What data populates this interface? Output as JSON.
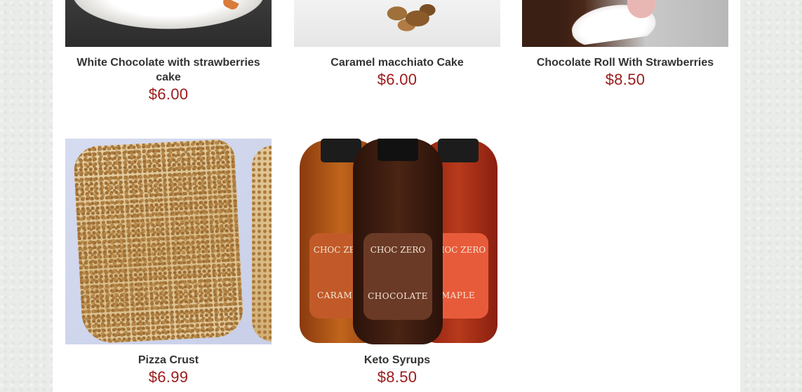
{
  "products": [
    {
      "title": "White Chocolate with strawberries cake",
      "price": "$6.00"
    },
    {
      "title": "Caramel macchiato Cake",
      "price": "$6.00"
    },
    {
      "title": "Chocolate Roll With Strawberries",
      "price": "$8.50"
    },
    {
      "title": "Pizza Crust",
      "price": "$6.99"
    },
    {
      "title": "Keto Syrups",
      "price": "$8.50"
    }
  ],
  "syrup_labels": {
    "brand": "CHOC ZERO",
    "left_variety": "CARAMEL",
    "middle_variety": "CHOCOLATE",
    "right_variety": "MAPLE"
  }
}
